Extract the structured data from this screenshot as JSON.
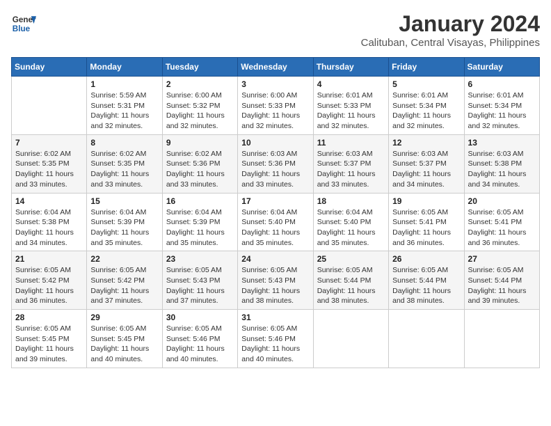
{
  "header": {
    "logo_line1": "General",
    "logo_line2": "Blue",
    "month": "January 2024",
    "location": "Calituban, Central Visayas, Philippines"
  },
  "days_of_week": [
    "Sunday",
    "Monday",
    "Tuesday",
    "Wednesday",
    "Thursday",
    "Friday",
    "Saturday"
  ],
  "weeks": [
    [
      {
        "day": "",
        "info": ""
      },
      {
        "day": "1",
        "info": "Sunrise: 5:59 AM\nSunset: 5:31 PM\nDaylight: 11 hours\nand 32 minutes."
      },
      {
        "day": "2",
        "info": "Sunrise: 6:00 AM\nSunset: 5:32 PM\nDaylight: 11 hours\nand 32 minutes."
      },
      {
        "day": "3",
        "info": "Sunrise: 6:00 AM\nSunset: 5:33 PM\nDaylight: 11 hours\nand 32 minutes."
      },
      {
        "day": "4",
        "info": "Sunrise: 6:01 AM\nSunset: 5:33 PM\nDaylight: 11 hours\nand 32 minutes."
      },
      {
        "day": "5",
        "info": "Sunrise: 6:01 AM\nSunset: 5:34 PM\nDaylight: 11 hours\nand 32 minutes."
      },
      {
        "day": "6",
        "info": "Sunrise: 6:01 AM\nSunset: 5:34 PM\nDaylight: 11 hours\nand 32 minutes."
      }
    ],
    [
      {
        "day": "7",
        "info": "Sunrise: 6:02 AM\nSunset: 5:35 PM\nDaylight: 11 hours\nand 33 minutes."
      },
      {
        "day": "8",
        "info": "Sunrise: 6:02 AM\nSunset: 5:35 PM\nDaylight: 11 hours\nand 33 minutes."
      },
      {
        "day": "9",
        "info": "Sunrise: 6:02 AM\nSunset: 5:36 PM\nDaylight: 11 hours\nand 33 minutes."
      },
      {
        "day": "10",
        "info": "Sunrise: 6:03 AM\nSunset: 5:36 PM\nDaylight: 11 hours\nand 33 minutes."
      },
      {
        "day": "11",
        "info": "Sunrise: 6:03 AM\nSunset: 5:37 PM\nDaylight: 11 hours\nand 33 minutes."
      },
      {
        "day": "12",
        "info": "Sunrise: 6:03 AM\nSunset: 5:37 PM\nDaylight: 11 hours\nand 34 minutes."
      },
      {
        "day": "13",
        "info": "Sunrise: 6:03 AM\nSunset: 5:38 PM\nDaylight: 11 hours\nand 34 minutes."
      }
    ],
    [
      {
        "day": "14",
        "info": "Sunrise: 6:04 AM\nSunset: 5:38 PM\nDaylight: 11 hours\nand 34 minutes."
      },
      {
        "day": "15",
        "info": "Sunrise: 6:04 AM\nSunset: 5:39 PM\nDaylight: 11 hours\nand 35 minutes."
      },
      {
        "day": "16",
        "info": "Sunrise: 6:04 AM\nSunset: 5:39 PM\nDaylight: 11 hours\nand 35 minutes."
      },
      {
        "day": "17",
        "info": "Sunrise: 6:04 AM\nSunset: 5:40 PM\nDaylight: 11 hours\nand 35 minutes."
      },
      {
        "day": "18",
        "info": "Sunrise: 6:04 AM\nSunset: 5:40 PM\nDaylight: 11 hours\nand 35 minutes."
      },
      {
        "day": "19",
        "info": "Sunrise: 6:05 AM\nSunset: 5:41 PM\nDaylight: 11 hours\nand 36 minutes."
      },
      {
        "day": "20",
        "info": "Sunrise: 6:05 AM\nSunset: 5:41 PM\nDaylight: 11 hours\nand 36 minutes."
      }
    ],
    [
      {
        "day": "21",
        "info": "Sunrise: 6:05 AM\nSunset: 5:42 PM\nDaylight: 11 hours\nand 36 minutes."
      },
      {
        "day": "22",
        "info": "Sunrise: 6:05 AM\nSunset: 5:42 PM\nDaylight: 11 hours\nand 37 minutes."
      },
      {
        "day": "23",
        "info": "Sunrise: 6:05 AM\nSunset: 5:43 PM\nDaylight: 11 hours\nand 37 minutes."
      },
      {
        "day": "24",
        "info": "Sunrise: 6:05 AM\nSunset: 5:43 PM\nDaylight: 11 hours\nand 38 minutes."
      },
      {
        "day": "25",
        "info": "Sunrise: 6:05 AM\nSunset: 5:44 PM\nDaylight: 11 hours\nand 38 minutes."
      },
      {
        "day": "26",
        "info": "Sunrise: 6:05 AM\nSunset: 5:44 PM\nDaylight: 11 hours\nand 38 minutes."
      },
      {
        "day": "27",
        "info": "Sunrise: 6:05 AM\nSunset: 5:44 PM\nDaylight: 11 hours\nand 39 minutes."
      }
    ],
    [
      {
        "day": "28",
        "info": "Sunrise: 6:05 AM\nSunset: 5:45 PM\nDaylight: 11 hours\nand 39 minutes."
      },
      {
        "day": "29",
        "info": "Sunrise: 6:05 AM\nSunset: 5:45 PM\nDaylight: 11 hours\nand 40 minutes."
      },
      {
        "day": "30",
        "info": "Sunrise: 6:05 AM\nSunset: 5:46 PM\nDaylight: 11 hours\nand 40 minutes."
      },
      {
        "day": "31",
        "info": "Sunrise: 6:05 AM\nSunset: 5:46 PM\nDaylight: 11 hours\nand 40 minutes."
      },
      {
        "day": "",
        "info": ""
      },
      {
        "day": "",
        "info": ""
      },
      {
        "day": "",
        "info": ""
      }
    ]
  ]
}
